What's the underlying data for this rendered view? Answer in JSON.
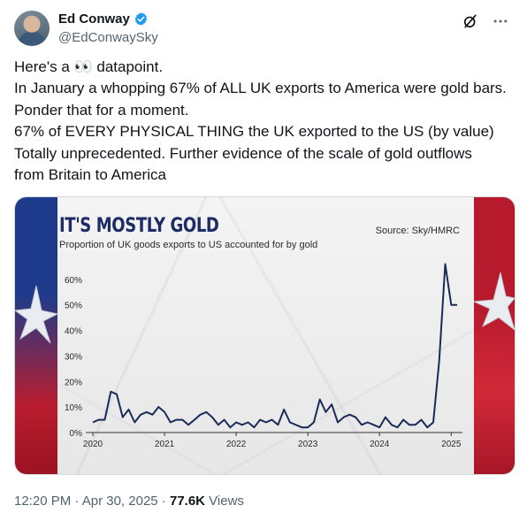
{
  "author": {
    "display_name": "Ed Conway",
    "handle": "@EdConwaySky"
  },
  "icons": {
    "verified": "verified-badge-icon",
    "grok": "grok-icon",
    "more": "more-horizontal-icon"
  },
  "colors": {
    "verified": "#1d9bf0",
    "title": "#1d2b66",
    "line": "#1a2b57",
    "muted": "#536471"
  },
  "tweet": {
    "lines": [
      "Here's a 👀 datapoint.",
      "In January a whopping 67% of ALL UK exports to America were gold bars.",
      "Ponder that for a moment.",
      "67% of EVERY PHYSICAL THING the UK exported to the US (by value)",
      "Totally unprecedented. Further evidence of the scale of gold outflows",
      "from Britain to America"
    ]
  },
  "chart_meta": {
    "title": "IT'S MOSTLY GOLD",
    "subtitle": "Proportion of UK goods exports to US accounted for by gold",
    "source": "Source: Sky/HMRC"
  },
  "chart_data": {
    "type": "line",
    "title": "IT'S MOSTLY GOLD",
    "subtitle": "Proportion of UK goods exports to US accounted for by gold",
    "source": "Source: Sky/HMRC",
    "xlabel": "",
    "ylabel": "",
    "ylim": [
      0,
      70
    ],
    "yticks": [
      "0%",
      "10%",
      "20%",
      "30%",
      "40%",
      "50%",
      "60%"
    ],
    "xticks": [
      "2020",
      "2021",
      "2022",
      "2023",
      "2024",
      "2025"
    ],
    "grid": false,
    "x": [
      2020.0,
      2020.083,
      2020.167,
      2020.25,
      2020.333,
      2020.417,
      2020.5,
      2020.583,
      2020.667,
      2020.75,
      2020.833,
      2020.917,
      2021.0,
      2021.083,
      2021.167,
      2021.25,
      2021.333,
      2021.417,
      2021.5,
      2021.583,
      2021.667,
      2021.75,
      2021.833,
      2021.917,
      2022.0,
      2022.083,
      2022.167,
      2022.25,
      2022.333,
      2022.417,
      2022.5,
      2022.583,
      2022.667,
      2022.75,
      2022.833,
      2022.917,
      2023.0,
      2023.083,
      2023.167,
      2023.25,
      2023.333,
      2023.417,
      2023.5,
      2023.583,
      2023.667,
      2023.75,
      2023.833,
      2023.917,
      2024.0,
      2024.083,
      2024.167,
      2024.25,
      2024.333,
      2024.417,
      2024.5,
      2024.583,
      2024.667,
      2024.75,
      2024.833,
      2024.917,
      2025.0,
      2025.083
    ],
    "series": [
      {
        "values": [
          4,
          5,
          5,
          16,
          15,
          6,
          9,
          4,
          7,
          8,
          7,
          10,
          8,
          4,
          5,
          5,
          3,
          5,
          7,
          8,
          6,
          3,
          5,
          2,
          4,
          3,
          4,
          2,
          5,
          4,
          5,
          3,
          9,
          4,
          3,
          2,
          2,
          4,
          13,
          8,
          11,
          4,
          6,
          7,
          6,
          3,
          4,
          3,
          2,
          6,
          3,
          2,
          5,
          3,
          3,
          5,
          2,
          4,
          28,
          66,
          50,
          50
        ]
      }
    ]
  },
  "footer": {
    "time": "12:20 PM",
    "separator": " · ",
    "date": "Apr 30, 2025",
    "views_count": "77.6K",
    "views_label": " Views"
  }
}
